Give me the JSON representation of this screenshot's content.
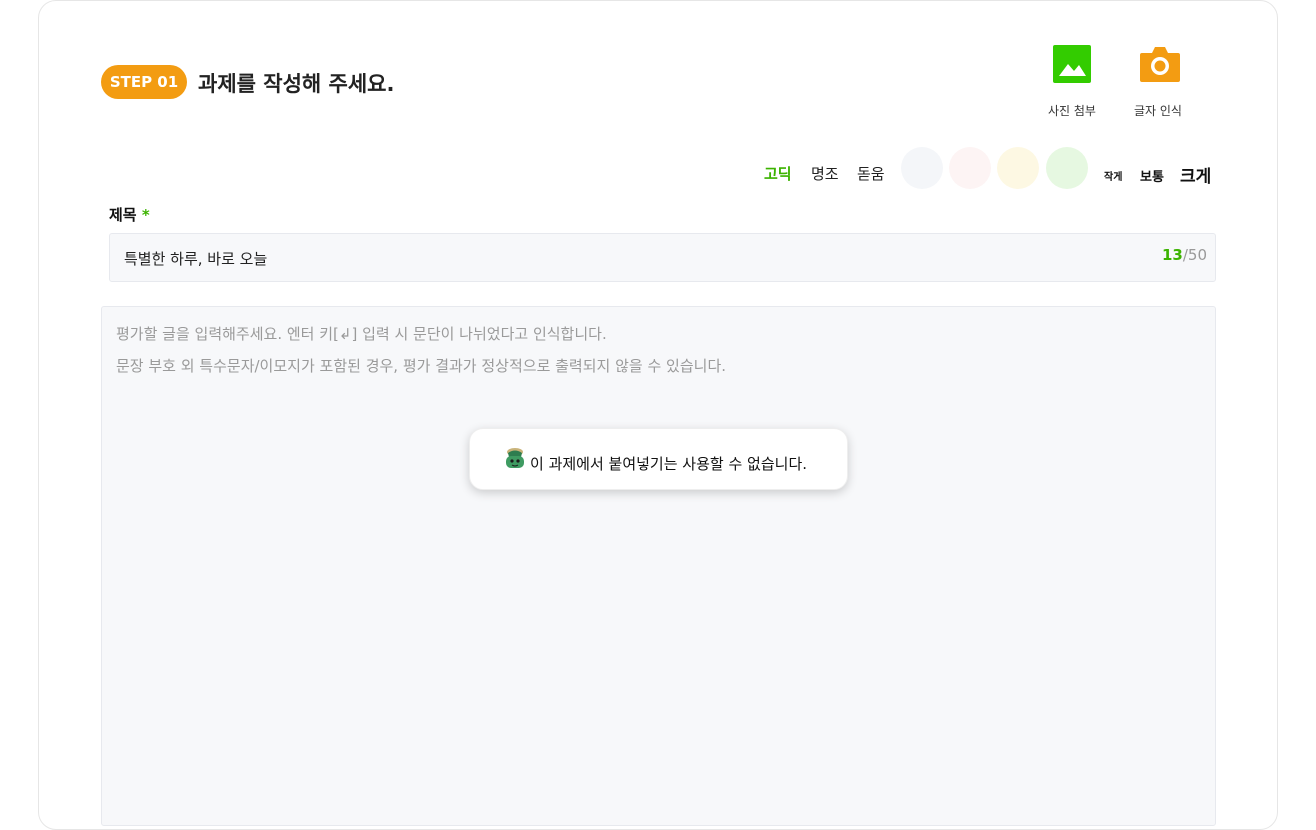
{
  "step": {
    "badge": "STEP 01",
    "title": "과제를 작성해 주세요."
  },
  "tools": {
    "photo": {
      "label": "사진 첨부",
      "icon": "image-icon",
      "color": "#33cc00"
    },
    "ocr": {
      "label": "글자 인식",
      "icon": "camera-icon",
      "color": "#f39c12"
    }
  },
  "fonts": [
    {
      "label": "고딕",
      "active": true
    },
    {
      "label": "명조",
      "active": false
    },
    {
      "label": "돋움",
      "active": false
    }
  ],
  "swatches": [
    "#f4f6f9",
    "#fdf4f4",
    "#fdf8e3",
    "#e6f8e1"
  ],
  "sizes": [
    {
      "label": "작게"
    },
    {
      "label": "보통"
    },
    {
      "label": "크게"
    }
  ],
  "title_field": {
    "label": "제목",
    "required_mark": "*",
    "value": "특별한 하루, 바로 오늘",
    "count": "13",
    "max": "/50"
  },
  "editor": {
    "placeholder_line1": "평가할 글을 입력해주세요. 엔터 키[↲] 입력 시 문단이 나뉘었다고 인식합니다.",
    "placeholder_line2": "문장 부호 외 특수문자/이모지가 포함된 경우, 평가 결과가 정상적으로 출력되지 않을 수 있습니다."
  },
  "toast": {
    "icon": "mascot-icon",
    "text": "이 과제에서 붙여넣기는 사용할 수 없습니다."
  },
  "colors": {
    "accent_green": "#3cb300",
    "accent_orange": "#f39c12"
  }
}
